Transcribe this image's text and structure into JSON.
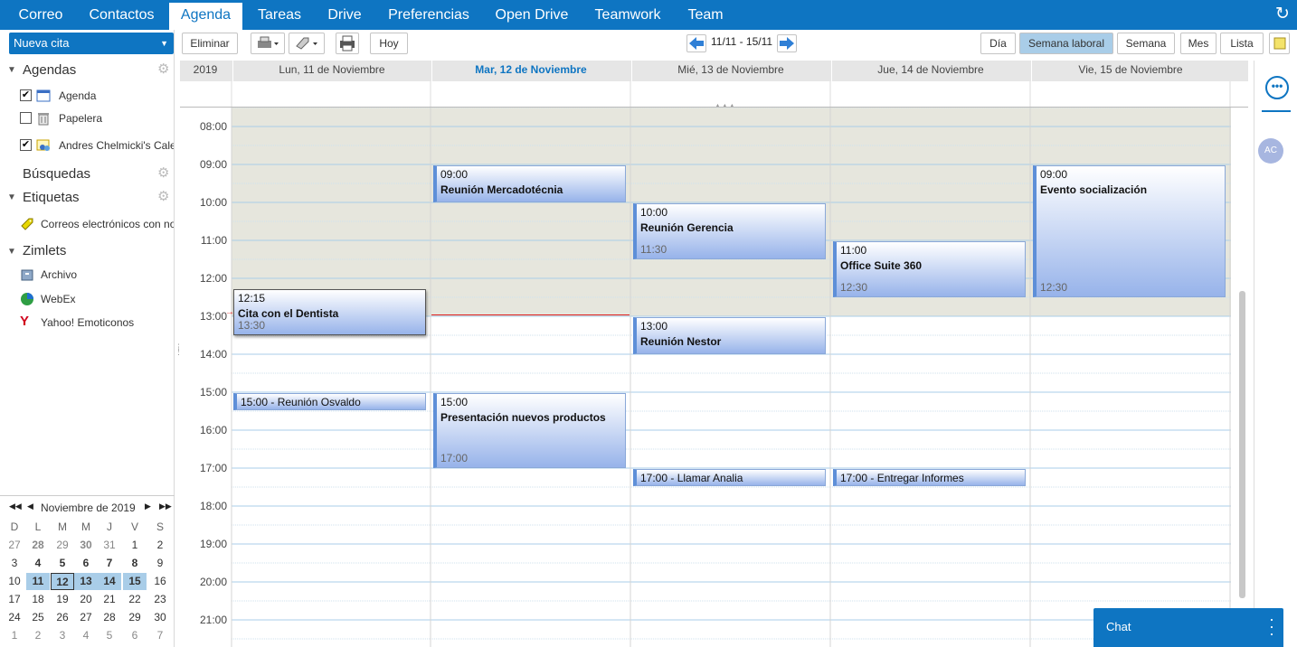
{
  "topnav": {
    "tabs": [
      {
        "label": "Correo"
      },
      {
        "label": "Contactos"
      },
      {
        "label": "Agenda"
      },
      {
        "label": "Tareas"
      },
      {
        "label": "Drive"
      },
      {
        "label": "Preferencias"
      },
      {
        "label": "Open Drive"
      },
      {
        "label": "Teamwork"
      },
      {
        "label": "Team"
      }
    ],
    "active": "Agenda",
    "refresh_icon": "↻"
  },
  "sidebar": {
    "new_button": "Nueva cita",
    "calendars_title": "Agendas",
    "calendars": [
      {
        "label": "Agenda",
        "checked": "✔"
      },
      {
        "label": "Papelera",
        "checked": ""
      },
      {
        "label": "Andres Chelmicki's Calendar",
        "checked": "✔"
      }
    ],
    "searches_title": "Búsquedas",
    "tags_title": "Etiquetas",
    "tags": [
      {
        "label": "Correos electrónicos con notas"
      }
    ],
    "zimlets_title": "Zimlets",
    "zimlets": [
      {
        "label": "Archivo"
      },
      {
        "label": "WebEx"
      },
      {
        "label": "Yahoo! Emoticonos"
      }
    ]
  },
  "toolbar": {
    "delete": "Eliminar",
    "today": "Hoy",
    "date_range": "11/11 - 15/11",
    "views": [
      {
        "label": "Día"
      },
      {
        "label": "Semana laboral"
      },
      {
        "label": "Semana"
      },
      {
        "label": "Mes"
      },
      {
        "label": "Lista"
      }
    ],
    "active_view": "Semana laboral"
  },
  "calendar": {
    "year": "2019",
    "days": [
      {
        "label": "Lun, 11 de Noviembre"
      },
      {
        "label": "Mar, 12 de Noviembre"
      },
      {
        "label": "Mié, 13 de Noviembre"
      },
      {
        "label": "Jue, 14 de Noviembre"
      },
      {
        "label": "Vie, 15 de Noviembre"
      }
    ],
    "today_index": 1,
    "hours": [
      "08:00",
      "09:00",
      "10:00",
      "11:00",
      "12:00",
      "13:00",
      "14:00",
      "15:00",
      "16:00",
      "17:00",
      "18:00",
      "19:00",
      "20:00",
      "21:00"
    ],
    "events": [
      {
        "day": 0,
        "start": "12:15",
        "name": "Cita con el Dentista",
        "end": "13:30"
      },
      {
        "day": 0,
        "start": "15:00",
        "name": "Reunión Osvaldo",
        "single": "15:00 - Reunión Osvaldo"
      },
      {
        "day": 1,
        "start": "09:00",
        "name": "Reunión Mercadotécnia",
        "end": ""
      },
      {
        "day": 1,
        "start": "15:00",
        "name": "Presentación nuevos productos",
        "end": "17:00"
      },
      {
        "day": 2,
        "start": "10:00",
        "name": "Reunión Gerencia",
        "end": "11:30"
      },
      {
        "day": 2,
        "start": "13:00",
        "name": "Reunión Nestor",
        "end": ""
      },
      {
        "day": 2,
        "start": "17:00",
        "name": "Llamar Analia",
        "single": "17:00 - Llamar Analia"
      },
      {
        "day": 3,
        "start": "11:00",
        "name": "Office Suite 360",
        "end": "12:30"
      },
      {
        "day": 3,
        "start": "17:00",
        "name": "Entregar Informes",
        "single": "17:00 - Entregar Informes"
      },
      {
        "day": 4,
        "start": "09:00",
        "name": "Evento socialización",
        "end": "12:30"
      }
    ]
  },
  "minical": {
    "title": "Noviembre de 2019",
    "dow": [
      "D",
      "L",
      "M",
      "M",
      "J",
      "V",
      "S"
    ],
    "weeks": [
      [
        "27",
        "28",
        "29",
        "30",
        "31",
        "1",
        "2"
      ],
      [
        "3",
        "4",
        "5",
        "6",
        "7",
        "8",
        "9"
      ],
      [
        "10",
        "11",
        "12",
        "13",
        "14",
        "15",
        "16"
      ],
      [
        "17",
        "18",
        "19",
        "20",
        "21",
        "22",
        "23"
      ],
      [
        "24",
        "25",
        "26",
        "27",
        "28",
        "29",
        "30"
      ],
      [
        "1",
        "2",
        "3",
        "4",
        "5",
        "6",
        "7"
      ]
    ]
  },
  "rightrail": {
    "avatar": "AC"
  },
  "chat": {
    "label": "Chat"
  },
  "colors": {
    "brand": "#0e75c2",
    "event_start": "#ffffff",
    "event_end": "#97b3ea",
    "now_line": "#e02020"
  }
}
